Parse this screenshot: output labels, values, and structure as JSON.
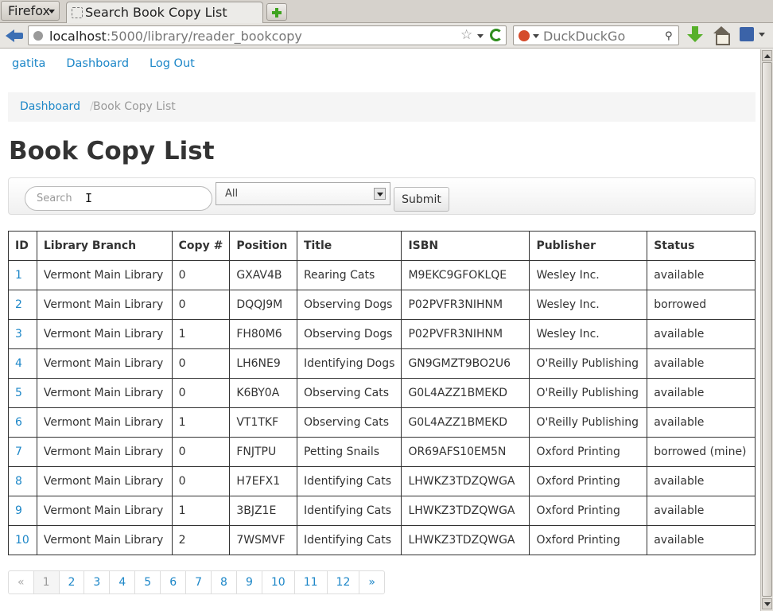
{
  "browser": {
    "menu_label": "Firefox",
    "tab_title": "Search Book Copy List",
    "url_host": "localhost",
    "url_rest": ":5000/library/reader_bookcopy",
    "search_engine": "DuckDuckGo"
  },
  "topnav": {
    "user": "gatita",
    "dashboard": "Dashboard",
    "logout": "Log Out"
  },
  "breadcrumb": {
    "home": "Dashboard",
    "separator": "/",
    "current": "Book Copy List"
  },
  "page": {
    "title": "Book Copy List"
  },
  "search": {
    "placeholder": "Search",
    "filter_value": "All",
    "submit_label": "Submit"
  },
  "table": {
    "columns": [
      "ID",
      "Library Branch",
      "Copy #",
      "Position",
      "Title",
      "ISBN",
      "Publisher",
      "Status"
    ],
    "rows": [
      [
        "1",
        "Vermont Main Library",
        "0",
        "GXAV4B",
        "Rearing Cats",
        "M9EKC9GFOKLQE",
        "Wesley Inc.",
        "available"
      ],
      [
        "2",
        "Vermont Main Library",
        "0",
        "DQQJ9M",
        "Observing Dogs",
        "P02PVFR3NIHNM",
        "Wesley Inc.",
        "borrowed"
      ],
      [
        "3",
        "Vermont Main Library",
        "1",
        "FH80M6",
        "Observing Dogs",
        "P02PVFR3NIHNM",
        "Wesley Inc.",
        "available"
      ],
      [
        "4",
        "Vermont Main Library",
        "0",
        "LH6NE9",
        "Identifying Dogs",
        "GN9GMZT9BO2U6",
        "O'Reilly Publishing",
        "available"
      ],
      [
        "5",
        "Vermont Main Library",
        "0",
        "K6BY0A",
        "Observing Cats",
        "G0L4AZZ1BMEKD",
        "O'Reilly Publishing",
        "available"
      ],
      [
        "6",
        "Vermont Main Library",
        "1",
        "VT1TKF",
        "Observing Cats",
        "G0L4AZZ1BMEKD",
        "O'Reilly Publishing",
        "available"
      ],
      [
        "7",
        "Vermont Main Library",
        "0",
        "FNJTPU",
        "Petting Snails",
        "OR69AFS10EM5N",
        "Oxford Printing",
        "borrowed (mine)"
      ],
      [
        "8",
        "Vermont Main Library",
        "0",
        "H7EFX1",
        "Identifying Cats",
        "LHWKZ3TDZQWGA",
        "Oxford Printing",
        "available"
      ],
      [
        "9",
        "Vermont Main Library",
        "1",
        "3BJZ1E",
        "Identifying Cats",
        "LHWKZ3TDZQWGA",
        "Oxford Printing",
        "available"
      ],
      [
        "10",
        "Vermont Main Library",
        "2",
        "7WSMVF",
        "Identifying Cats",
        "LHWKZ3TDZQWGA",
        "Oxford Printing",
        "available"
      ]
    ]
  },
  "pagination": {
    "prev": "«",
    "pages": [
      "1",
      "2",
      "3",
      "4",
      "5",
      "6",
      "7",
      "8",
      "9",
      "10",
      "11",
      "12"
    ],
    "current": "1",
    "next": "»"
  },
  "colors": {
    "link": "#1d87c8",
    "breadcrumb_bg": "#f5f5f5"
  }
}
